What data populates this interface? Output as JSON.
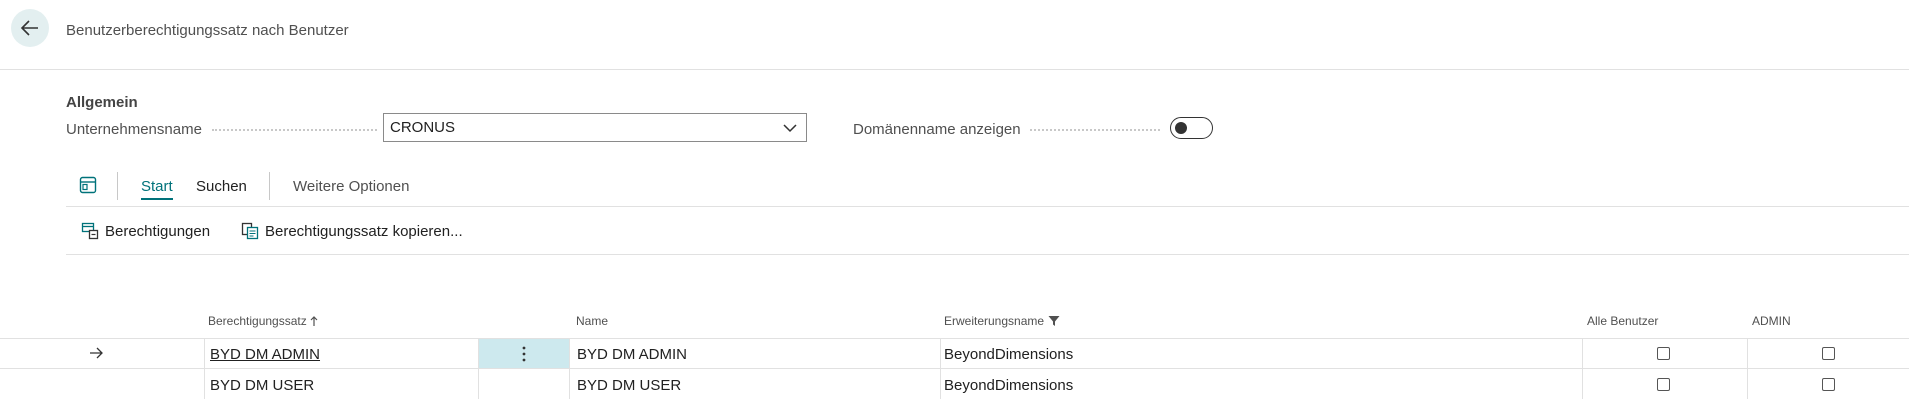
{
  "header": {
    "title": "Benutzerberechtigungssatz nach Benutzer"
  },
  "general": {
    "section_title": "Allgemein",
    "company_label": "Unternehmensname",
    "company_value": "CRONUS",
    "domain_label": "Domänenname anzeigen",
    "domain_toggle_on": false
  },
  "action_bar": {
    "tabs": [
      {
        "label": "Start",
        "active": true
      },
      {
        "label": "Suchen",
        "active": false
      }
    ],
    "more_options": "Weitere Optionen",
    "actions": [
      {
        "label": "Berechtigungen",
        "icon": "permissions-icon"
      },
      {
        "label": "Berechtigungssatz kopieren...",
        "icon": "copy-icon"
      }
    ]
  },
  "table": {
    "columns": {
      "permission_set": "Berechtigungssatz",
      "name": "Name",
      "extension_name": "Erweiterungsname",
      "all_users": "Alle Benutzer",
      "admin": "ADMIN"
    },
    "rows": [
      {
        "permission_set": "BYD DM ADMIN",
        "name": "BYD DM ADMIN",
        "extension_name": "BeyondDimensions",
        "all_users": false,
        "admin": false,
        "current": true
      },
      {
        "permission_set": "BYD DM USER",
        "name": "BYD DM USER",
        "extension_name": "BeyondDimensions",
        "all_users": false,
        "admin": false,
        "current": false
      }
    ]
  },
  "colors": {
    "accent": "#00727a",
    "selected_cell": "#cde9ee"
  }
}
